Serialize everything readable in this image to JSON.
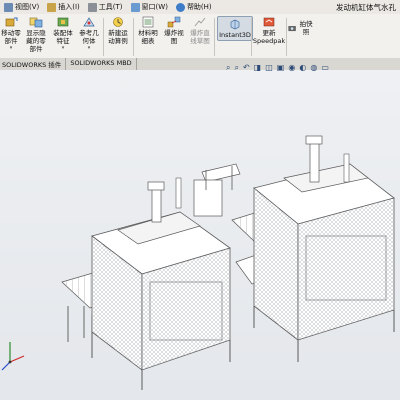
{
  "menubar": {
    "items": [
      {
        "label": "视图(V)",
        "icon": "view-menu-icon"
      },
      {
        "label": "插入(I)",
        "icon": "insert-menu-icon"
      },
      {
        "label": "工具(T)",
        "icon": "tools-menu-icon"
      },
      {
        "label": "窗口(W)",
        "icon": "window-menu-icon"
      },
      {
        "label": "帮助(H)",
        "icon": "help-menu-icon"
      }
    ],
    "document_title": "发动机缸体气水孔"
  },
  "ribbon": {
    "tools": [
      {
        "line1": "移动零",
        "line2": "部件",
        "icon": "move-component-icon",
        "dropdown": true
      },
      {
        "line1": "显示隐",
        "line2": "藏的零",
        "line3": "部件",
        "icon": "show-hidden-icon",
        "dropdown": false
      },
      {
        "line1": "装配体",
        "line2": "特征",
        "icon": "assembly-feature-icon",
        "dropdown": true
      },
      {
        "line1": "参考几",
        "line2": "何体",
        "icon": "reference-geometry-icon",
        "dropdown": true
      },
      {
        "line1": "新建运",
        "line2": "动算例",
        "icon": "new-motion-study-icon",
        "dropdown": false
      },
      {
        "line1": "材料明",
        "line2": "细表",
        "icon": "bill-of-materials-icon",
        "dropdown": false
      },
      {
        "line1": "爆炸视",
        "line2": "图",
        "icon": "exploded-view-icon",
        "dropdown": false
      },
      {
        "line1": "爆炸直",
        "line2": "线草图",
        "icon": "explode-line-sketch-icon",
        "dropdown": false
      },
      {
        "line1": "Instant3D",
        "icon": "instant3d-icon",
        "dropdown": false
      },
      {
        "line1": "更新",
        "line2": "Speedpak",
        "icon": "update-speedpak-icon",
        "dropdown": false
      },
      {
        "line1": "拍快照",
        "icon": "take-snapshot-icon",
        "dropdown": false
      }
    ]
  },
  "tabs": [
    {
      "label": "SOLIDWORKS 插件"
    },
    {
      "label": "SOLIDWORKS MBD"
    }
  ],
  "colors": {
    "machine": "#ffffff",
    "outline": "#5a5a5a",
    "mesh": "#9aa0a8",
    "accent": "#2c4a77"
  }
}
